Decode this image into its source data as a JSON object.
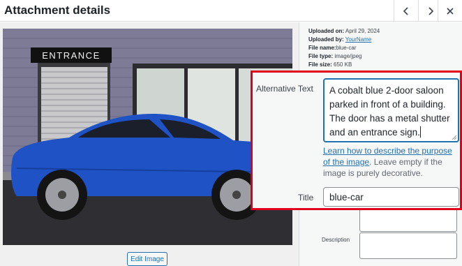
{
  "header": {
    "title": "Attachment details",
    "prev_icon": "chevron-left-icon",
    "next_icon": "chevron-right-icon",
    "close_icon": "close-icon"
  },
  "media": {
    "photo_sign_text": "ENTRANCE",
    "edit_button_label": "Edit Image"
  },
  "details": {
    "uploaded_on_label": "Uploaded on:",
    "uploaded_on_value": "April 29, 2024",
    "uploaded_by_label": "Uploaded by:",
    "uploaded_by_value": "YourName",
    "file_name_label": "File name:",
    "file_name_value": "blue-car",
    "file_type_label": "File type:",
    "file_type_value": "image/jpeg",
    "file_size_label": "File size:",
    "file_size_value": "650 KB",
    "description_label": "Description"
  },
  "zoom": {
    "alt_label": "Alternative Text",
    "alt_value": "A cobalt blue 2-door saloon parked in front of a building. The door has a metal shutter and an entrance sign.",
    "help_link": "Learn how to describe the purpose of the image",
    "help_rest": ". Leave empty if the image is purely decorative.",
    "title_label": "Title",
    "title_value": "blue-car"
  },
  "colors": {
    "highlight": "#e0001b",
    "accent": "#2271b1",
    "car": "#1f52c4"
  }
}
